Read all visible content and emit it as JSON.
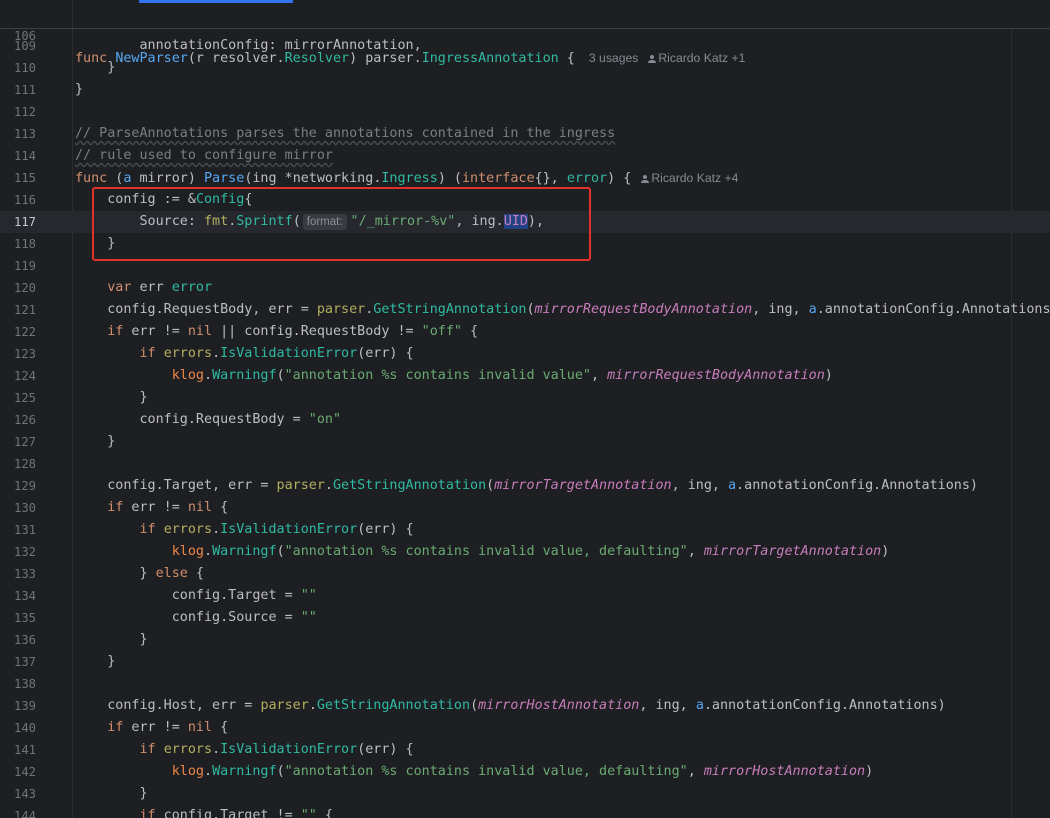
{
  "editor": {
    "sticky_line": {
      "number": "106",
      "text_parts": [
        "func ",
        "NewParser",
        "(r resolver.",
        "Resolver",
        ") parser.",
        "IngressAnnotation",
        " {"
      ],
      "usages": "3 usages",
      "author": "Ricardo Katz +1"
    },
    "parse_author": "Ricardo Katz +4",
    "format_hint": "format:",
    "lines": [
      {
        "n": "109",
        "code": "        annotationConfig: mirrorAnnotation,"
      },
      {
        "n": "110",
        "code": "    }"
      },
      {
        "n": "111",
        "code": "}"
      },
      {
        "n": "112",
        "code": ""
      },
      {
        "n": "113",
        "code": "// ParseAnnotations parses the annotations contained in the ingress"
      },
      {
        "n": "114",
        "code": "// rule used to configure mirror"
      },
      {
        "n": "115",
        "code": "func (a mirror) Parse(ing *networking.Ingress) (interface{}, error) {"
      },
      {
        "n": "116",
        "code": "    config := &Config{"
      },
      {
        "n": "117",
        "code": "        Source: fmt.Sprintf(\"/_mirror-%v\", ing.UID),"
      },
      {
        "n": "118",
        "code": "    }"
      },
      {
        "n": "119",
        "code": ""
      },
      {
        "n": "120",
        "code": "    var err error"
      },
      {
        "n": "121",
        "code": "    config.RequestBody, err = parser.GetStringAnnotation(mirrorRequestBodyAnnotation, ing, a.annotationConfig.Annotations)"
      },
      {
        "n": "122",
        "code": "    if err != nil || config.RequestBody != \"off\" {"
      },
      {
        "n": "123",
        "code": "        if errors.IsValidationError(err) {"
      },
      {
        "n": "124",
        "code": "            klog.Warningf(\"annotation %s contains invalid value\", mirrorRequestBodyAnnotation)"
      },
      {
        "n": "125",
        "code": "        }"
      },
      {
        "n": "126",
        "code": "        config.RequestBody = \"on\""
      },
      {
        "n": "127",
        "code": "    }"
      },
      {
        "n": "128",
        "code": ""
      },
      {
        "n": "129",
        "code": "    config.Target, err = parser.GetStringAnnotation(mirrorTargetAnnotation, ing, a.annotationConfig.Annotations)"
      },
      {
        "n": "130",
        "code": "    if err != nil {"
      },
      {
        "n": "131",
        "code": "        if errors.IsValidationError(err) {"
      },
      {
        "n": "132",
        "code": "            klog.Warningf(\"annotation %s contains invalid value, defaulting\", mirrorTargetAnnotation)"
      },
      {
        "n": "133",
        "code": "        } else {"
      },
      {
        "n": "134",
        "code": "            config.Target = \"\""
      },
      {
        "n": "135",
        "code": "            config.Source = \"\""
      },
      {
        "n": "136",
        "code": "        }"
      },
      {
        "n": "137",
        "code": "    }"
      },
      {
        "n": "138",
        "code": ""
      },
      {
        "n": "139",
        "code": "    config.Host, err = parser.GetStringAnnotation(mirrorHostAnnotation, ing, a.annotationConfig.Annotations)"
      },
      {
        "n": "140",
        "code": "    if err != nil {"
      },
      {
        "n": "141",
        "code": "        if errors.IsValidationError(err) {"
      },
      {
        "n": "142",
        "code": "            klog.Warningf(\"annotation %s contains invalid value, defaulting\", mirrorHostAnnotation)"
      },
      {
        "n": "143",
        "code": "        }"
      },
      {
        "n": "144",
        "code": "        if config.Target != \"\" {"
      }
    ],
    "current_line": "117",
    "colors": {
      "background": "#1e1f22",
      "keyword": "#cf8e6d",
      "function": "#56a8f5",
      "type": "#2fbaa3",
      "string": "#6aab73",
      "comment": "#7a7e85",
      "constant": "#c77dbb",
      "highlight_box": "#e0312a"
    }
  }
}
